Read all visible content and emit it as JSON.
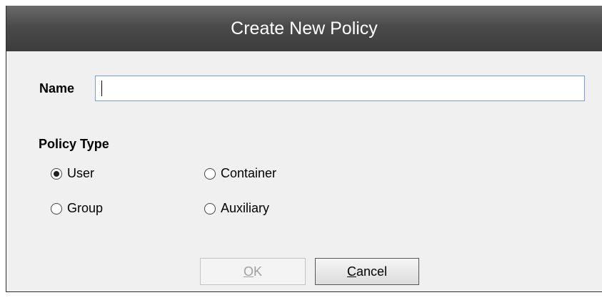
{
  "window": {
    "title": "Create New Policy"
  },
  "form": {
    "name_label": "Name",
    "name_value": "",
    "policy_type_label": "Policy Type",
    "options": [
      {
        "label": "User",
        "checked": true
      },
      {
        "label": "Container",
        "checked": false
      },
      {
        "label": "Group",
        "checked": false
      },
      {
        "label": "Auxiliary",
        "checked": false
      }
    ]
  },
  "buttons": {
    "ok_access_key": "O",
    "ok_rest": "K",
    "cancel_access_key": "C",
    "cancel_rest": "ancel"
  }
}
